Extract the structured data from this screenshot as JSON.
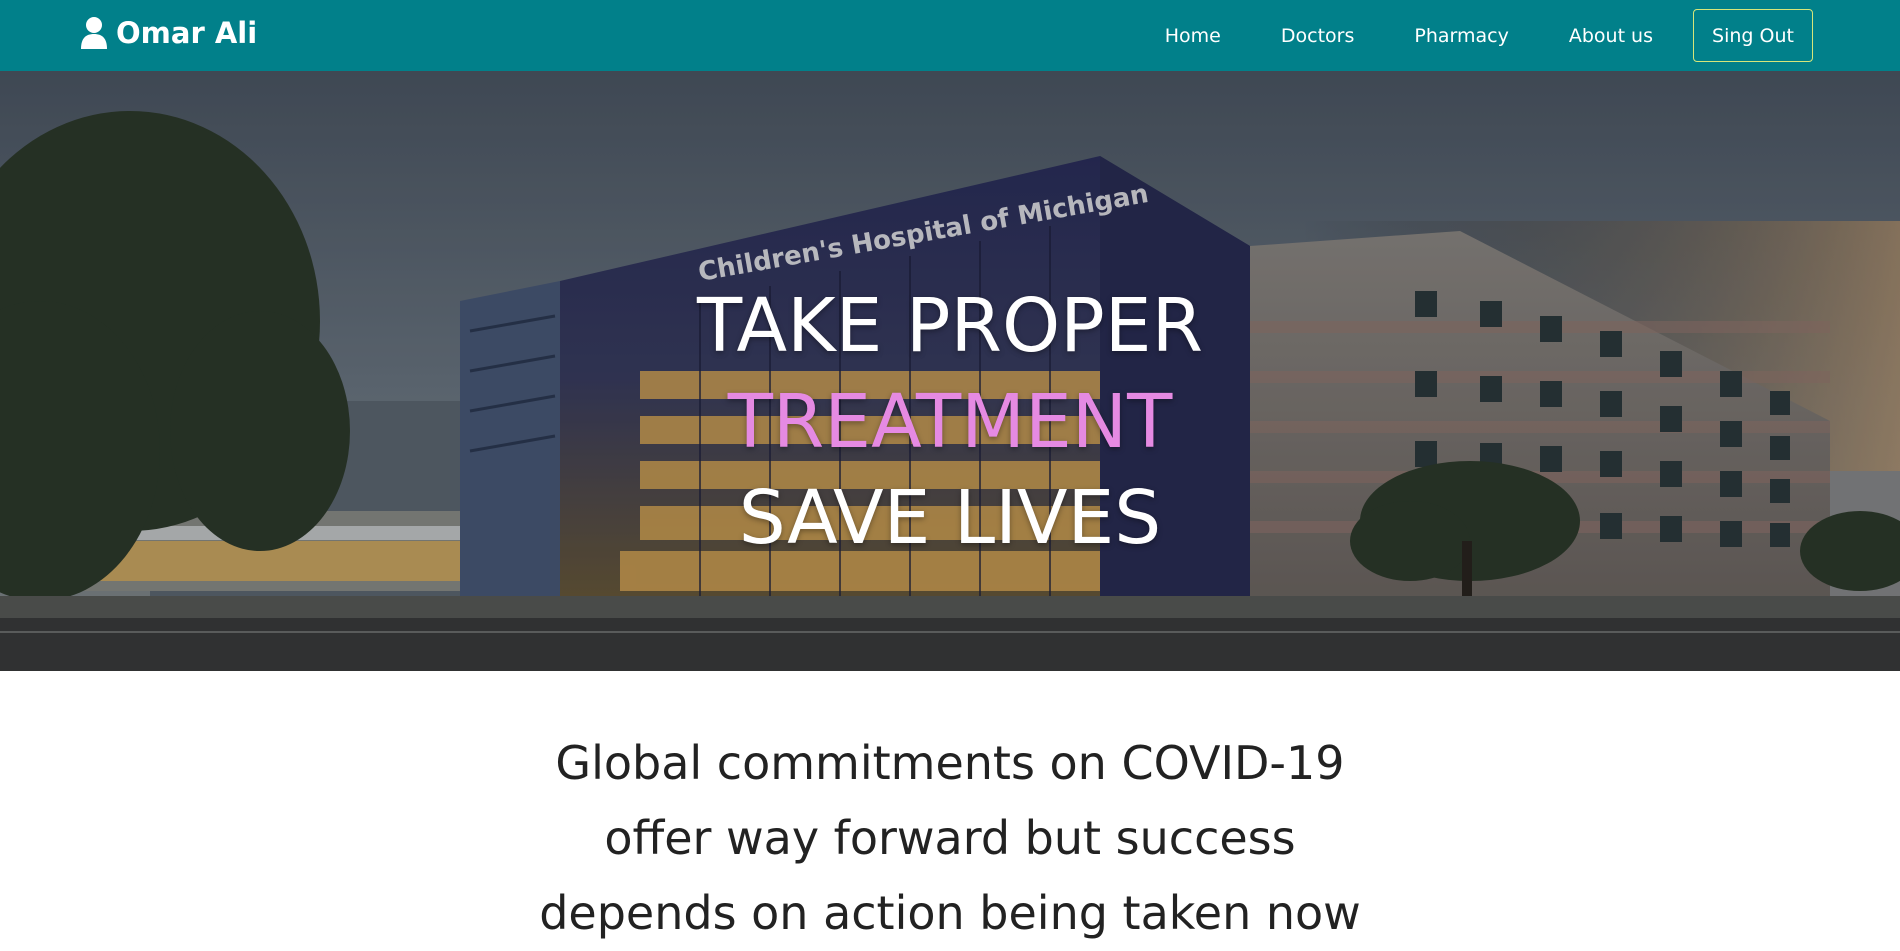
{
  "header": {
    "user_name": "Omar Ali",
    "nav": {
      "home": "Home",
      "doctors": "Doctors",
      "pharmacy": "Pharmacy",
      "about": "About us",
      "sign_out": "Sing Out"
    },
    "colors": {
      "background": "#01808a",
      "sign_out_border": "#d6e67a"
    }
  },
  "hero": {
    "line1": "TAKE PROPER",
    "line2": "TREATMENT",
    "line3": "SAVE LIVES",
    "accent_color": "#e58ae2",
    "building_sign": "Children's Hospital of Michigan"
  },
  "main": {
    "headline": "Global commitments on COVID-19 offer way forward but success depends on action being taken now"
  }
}
